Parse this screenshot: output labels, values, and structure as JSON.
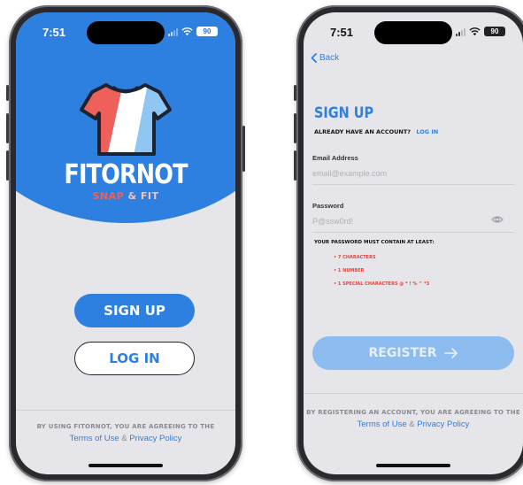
{
  "left": {
    "status_time": "7:51",
    "battery": "90",
    "brand": "FITORNOT",
    "tagline_snap": "SNAP",
    "tagline_rest": "& FIT",
    "signup_label": "SIGN UP",
    "login_label": "LOG IN",
    "legal_text": "BY USING FITORNOT, YOU ARE AGREEING TO THE",
    "terms_label": "Terms of Use",
    "amp": "&",
    "privacy_label": "Privacy Policy"
  },
  "right": {
    "status_time": "7:51",
    "battery": "90",
    "back_label": "Back",
    "title": "SIGN UP",
    "have_account_text": "ALREADY HAVE AN ACCOUNT?",
    "login_link": "LOG IN",
    "email_label": "Email Address",
    "email_placeholder": "email@example.com",
    "password_label": "Password",
    "password_placeholder": "P@ssw0rd!",
    "requirements_title": "YOUR PASSWORD MUST CONTAIN AT LEAST:",
    "requirements": [
      "• 7 CHARACTERS",
      "• 1 NUMBER",
      "• 1 SPECIAL CHARACTERS @ * ! % ^ *3"
    ],
    "register_label": "REGISTER",
    "legal_text": "BY REGISTERING AN ACCOUNT, YOU ARE AGREEING TO THE",
    "terms_label": "Terms of Use",
    "amp": "&",
    "privacy_label": "Privacy Policy"
  },
  "colors": {
    "brand_blue": "#2d7fe0",
    "register_disabled": "#8dbcf0",
    "error_red": "#e0443e",
    "screen_bg": "#e6e6ea"
  }
}
